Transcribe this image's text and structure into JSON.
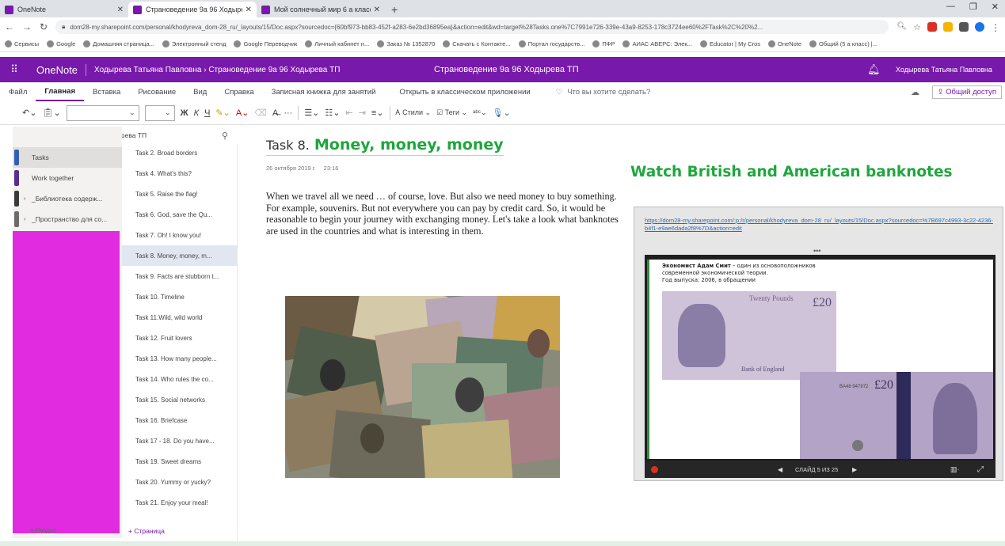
{
  "browser": {
    "tabs": [
      {
        "title": "OneNote",
        "active": false
      },
      {
        "title": "Страноведение 9а 96 Ходырева",
        "active": true
      },
      {
        "title": "Мой солнечный мир 6 а класс",
        "active": false
      }
    ],
    "url": "dom28-my.sharepoint.com/personal/khodyreva_dom-28_ru/_layouts/15/Doc.aspx?sourcedoc={60bf973-bb83-452f-a283-6e2bd36895ea}&action=edit&wd=target%28Tasks.one%7C7991e726-339e-43a9-8253-178c3724ee60%2FTask%2C%20%2...",
    "bookmarks": [
      "Сервисы",
      "Google",
      "Домашняя страница...",
      "Электронный стенд",
      "Google Переводчик",
      "Личный кабинет н...",
      "Заказ № 1352870",
      "Скачать с Контакте...",
      "Портал государств...",
      "ПФР",
      "АИАС АВЕРС: Элек...",
      "Educator | My Cros",
      "OneNote",
      "Общий (5 а класс) |..."
    ]
  },
  "onenote": {
    "app_name": "OneNote",
    "breadcrumb": "Ходырева Татьяна Павловна › Страноведение 9а 96 Ходырева ТП",
    "center_title": "Страноведение 9а 96 Ходырева ТП",
    "user": "Ходырева Татьяна Павловна",
    "accent": "#7719aa"
  },
  "ribbon": {
    "tabs": [
      "Файл",
      "Главная",
      "Вставка",
      "Рисование",
      "Вид",
      "Справка",
      "Записная книжка для занятий",
      "Открыть в классическом приложении"
    ],
    "active_tab": "Главная",
    "search_placeholder": "Что вы хотите сделать?",
    "share_label": "Общий доступ",
    "toolbar": {
      "bold": "Ж",
      "italic": "К",
      "underline": "Ч",
      "more": "···",
      "styles": "Стили",
      "tags": "Теги"
    }
  },
  "notebook": {
    "name": "Страноведение 9а 96 Ходырева ТП",
    "sections": [
      {
        "label": "Tasks",
        "color": "#2f5fae",
        "active": true
      },
      {
        "label": "Work together",
        "color": "#5c2d91",
        "active": false
      },
      {
        "label": "_Библиотека содерж...",
        "color": "#3b3b3b",
        "active": false,
        "group": true
      },
      {
        "label": "_Пространство для со...",
        "color": "#6b6b6b",
        "active": false,
        "group": true
      }
    ],
    "add_section": "+ Раздел",
    "pages": [
      "Task 2. Broad borders",
      "Task 4. What's this?",
      "Task 5. Raise the flag!",
      "Task 6. God, save the Qu...",
      "Task 7. Oh! I know you!",
      "Task 8. Money, money, m...",
      "Task 9. Facts are stubborn t...",
      "Task 10. Timeline",
      "Task 11.Wild, wild world",
      "Task 12. Fruit lovers",
      "Task 13. How many people...",
      "Task 14. Who rules the co...",
      "Task 15. Social networks",
      "Task 16. Briefcase",
      "Task 17 - 18. Do you have...",
      "Task 19. Sweet dreams",
      "Task 20. Yummy or yucky?",
      "Task 21. Enjoy your meal!"
    ],
    "active_page_index": 5,
    "add_page": "+ Страница"
  },
  "page": {
    "title_prefix": "Task 8.",
    "title_main": "Money, money, money",
    "date": "26 октября 2019 г.",
    "time": "23:16",
    "body": "When we travel all we need … of course, love. But also we need money to buy something. For example, souvenirs. But not everywhere you can pay by credit card. So, it would be reasonable to begin your journey with exchanging money. Let's take a look what banknotes are used in the countries and what is interesting in them.",
    "right_heading": "Watch British and American banknotes",
    "embed": {
      "link": "https://dom28-my.sharepoint.com/:p:/r/personal/khodyreva_dom-28_ru/_layouts/15/Doc.aspx?sourcedoc=%7B697c4993-3c22-4236-b4f1-e9ae6dada2f8%7D&action=edit",
      "caption_bold": "Экономист Адам Смит",
      "caption_rest": " – один из основоположников современной экономической теории.",
      "caption_year": "Год выпуска: 2006, в обращении",
      "note_value": "£20",
      "note_bank": "Bank of England",
      "note_words": "Twenty Pounds",
      "serial": "BA48 947972",
      "slide_counter": "СЛАЙД 5 ИЗ 25"
    }
  },
  "colors": {
    "green_heading": "#1ea73c",
    "section_highlight": "#e02be0"
  }
}
